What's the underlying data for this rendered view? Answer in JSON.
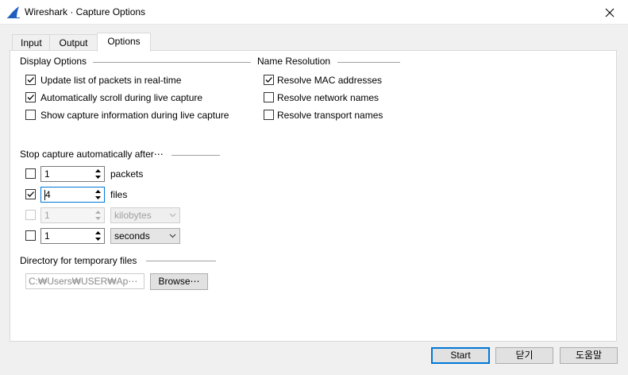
{
  "window": {
    "title": "Wireshark · Capture Options",
    "app_icon": "wireshark-fin-icon",
    "close_icon": "close-icon",
    "accent_color": "#0078d7",
    "icon_color": "#1f5fbf"
  },
  "tabs": [
    {
      "label": "Input",
      "active": false
    },
    {
      "label": "Output",
      "active": false
    },
    {
      "label": "Options",
      "active": true
    }
  ],
  "display_options": {
    "title": "Display Options",
    "items": [
      {
        "label": "Update list of packets in real-time",
        "checked": true
      },
      {
        "label": "Automatically scroll during live capture",
        "checked": true
      },
      {
        "label": "Show capture information during live capture",
        "checked": false
      }
    ]
  },
  "name_resolution": {
    "title": "Name Resolution",
    "items": [
      {
        "label": "Resolve MAC addresses",
        "checked": true
      },
      {
        "label": "Resolve network names",
        "checked": false
      },
      {
        "label": "Resolve transport names",
        "checked": false
      }
    ]
  },
  "stop_capture": {
    "title": "Stop capture automatically after⋯",
    "rows": [
      {
        "checked": false,
        "value": "1",
        "unit": "packets",
        "unit_is_combo": false,
        "enabled": true
      },
      {
        "checked": true,
        "value": "4",
        "unit": "files",
        "unit_is_combo": false,
        "enabled": true,
        "focused": true
      },
      {
        "checked": false,
        "value": "1",
        "unit": "kilobytes",
        "unit_is_combo": true,
        "enabled": false
      },
      {
        "checked": false,
        "value": "1",
        "unit": "seconds",
        "unit_is_combo": true,
        "enabled": true
      }
    ]
  },
  "temp_dir": {
    "title": "Directory for temporary files",
    "path_value": "C:₩Users₩USER₩Ap⋯",
    "browse_label": "Browse⋯"
  },
  "buttons": {
    "start": "Start",
    "close": "닫기",
    "help": "도움말"
  }
}
